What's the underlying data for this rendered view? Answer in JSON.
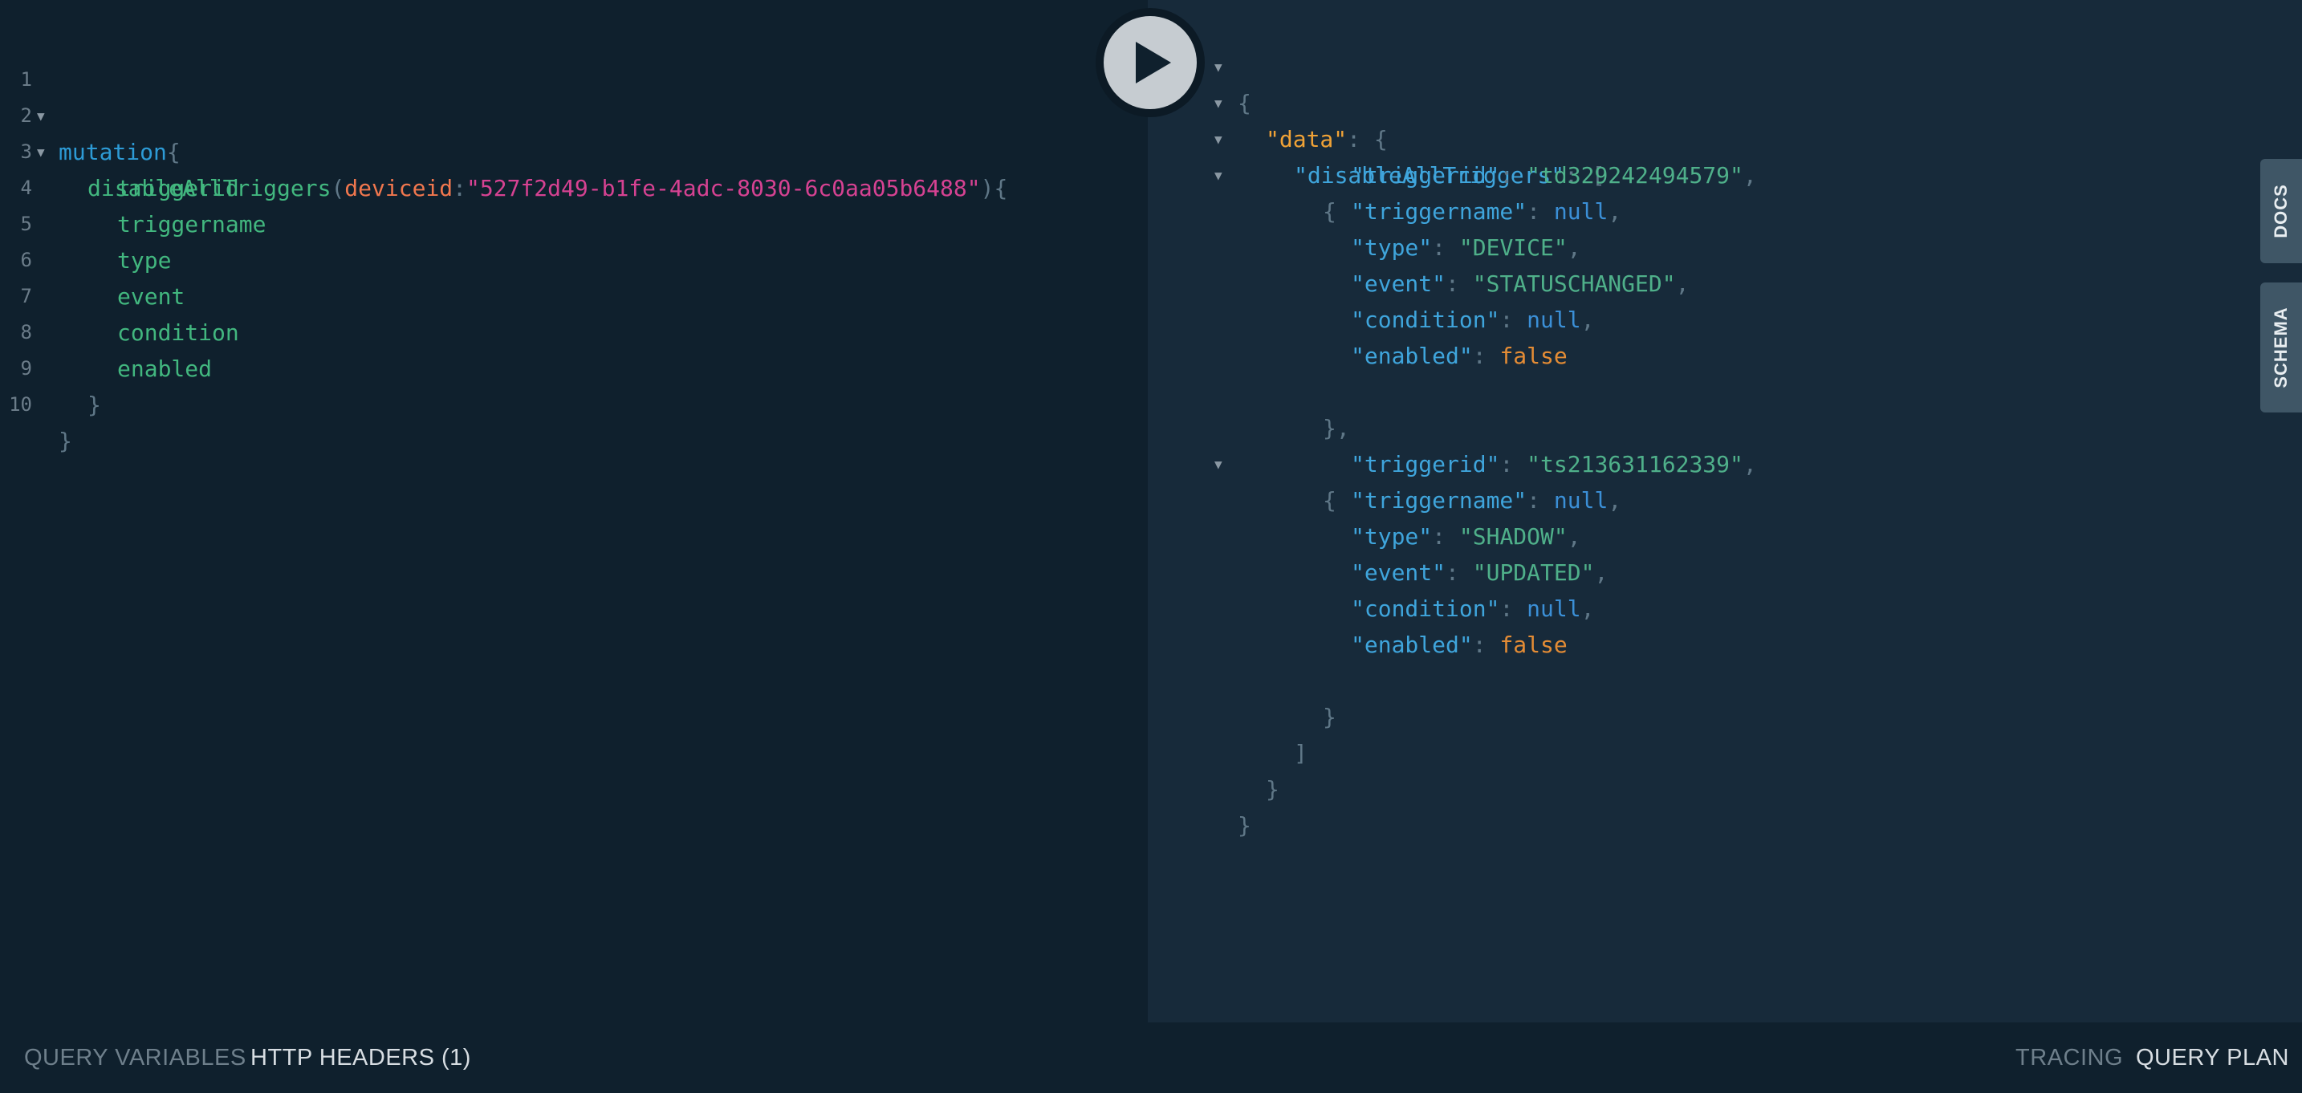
{
  "query": {
    "line_numbers": [
      "1",
      "2",
      "3",
      "4",
      "5",
      "6",
      "7",
      "8",
      "9",
      "10"
    ],
    "l1_keyword": "mutation",
    "l1_brace": "{",
    "l2_field": "disableAllTriggers",
    "l2_open": "(",
    "l2_argname": "deviceid",
    "l2_colon": ":",
    "l2_argval": "\"527f2d49-b1fe-4adc-8030-6c0aa05b6488\"",
    "l2_close": "){",
    "fields": [
      "triggerid",
      "triggername",
      "type",
      "event",
      "condition",
      "enabled"
    ],
    "l9_brace": "}",
    "l10_brace": "}"
  },
  "result": {
    "open_brace": "{",
    "data_key": "\"data\"",
    "colon_brace": ": {",
    "array_key": "\"disableAllTriggers\"",
    "colon_bracket": ": [",
    "obj_open": "{",
    "obj1_close": "},",
    "obj2_close": "}",
    "array_close": "]",
    "data_close": "}",
    "root_close": "}",
    "objects": [
      {
        "triggerid_key": "\"triggerid\"",
        "triggerid_val": "\"td329242494579\"",
        "triggername_key": "\"triggername\"",
        "triggername_val": "null",
        "type_key": "\"type\"",
        "type_val": "\"DEVICE\"",
        "event_key": "\"event\"",
        "event_val": "\"STATUSCHANGED\"",
        "condition_key": "\"condition\"",
        "condition_val": "null",
        "enabled_key": "\"enabled\"",
        "enabled_val": "false"
      },
      {
        "triggerid_key": "\"triggerid\"",
        "triggerid_val": "\"ts213631162339\"",
        "triggername_key": "\"triggername\"",
        "triggername_val": "null",
        "type_key": "\"type\"",
        "type_val": "\"SHADOW\"",
        "event_key": "\"event\"",
        "event_val": "\"UPDATED\"",
        "condition_key": "\"condition\"",
        "condition_val": "null",
        "enabled_key": "\"enabled\"",
        "enabled_val": "false"
      }
    ],
    "sep_comma": ",",
    "sep_colon": ": "
  },
  "side_tabs": {
    "docs": "DOCS",
    "schema": "SCHEMA"
  },
  "bottom": {
    "query_variables": "QUERY VARIABLES",
    "http_headers": "HTTP HEADERS (1)",
    "tracing": "TRACING",
    "query_plan": "QUERY PLAN"
  },
  "icons": {
    "run": "play-icon",
    "fold": "fold-arrow-icon"
  },
  "colors": {
    "editor_bg": "#0f202d",
    "results_bg": "#172a3a",
    "field": "#42b77f",
    "keyword": "#2d9bd6",
    "string": "#4fb08a",
    "null": "#3b8fd6",
    "boolean": "#e48c35",
    "arg_value": "#d64292"
  }
}
